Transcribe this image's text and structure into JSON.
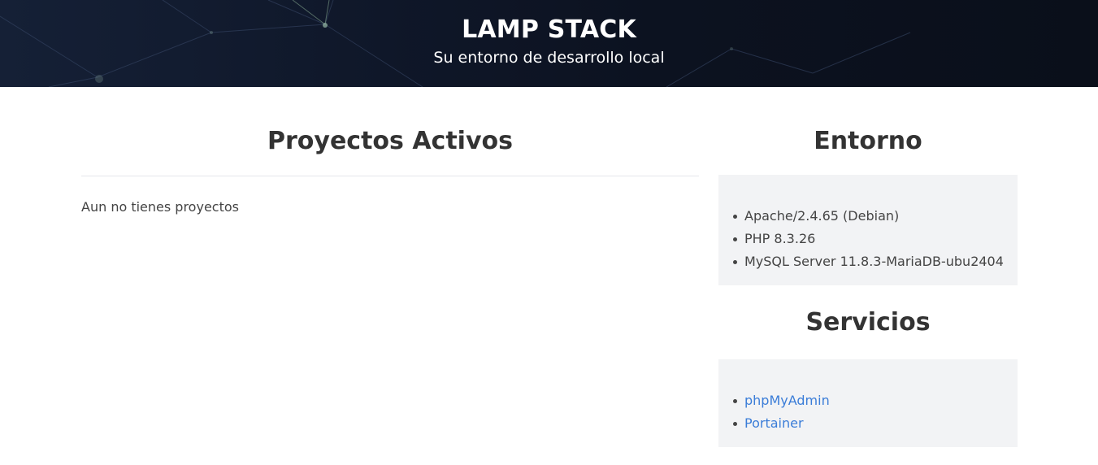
{
  "header": {
    "title": "LAMP STACK",
    "subtitle": "Su entorno de desarrollo local"
  },
  "projects": {
    "heading": "Proyectos Activos",
    "empty_message": "Aun no tienes proyectos"
  },
  "environment": {
    "heading": "Entorno",
    "items": [
      "Apache/2.4.65 (Debian)",
      "PHP 8.3.26",
      "MySQL Server 11.8.3-MariaDB-ubu2404"
    ]
  },
  "services": {
    "heading": "Servicios",
    "links": [
      "phpMyAdmin",
      "Portainer"
    ]
  },
  "colors": {
    "header_bg": "#0f1729",
    "link": "#3b7dd8",
    "panel_bg": "#f2f3f5",
    "text": "#333333"
  }
}
